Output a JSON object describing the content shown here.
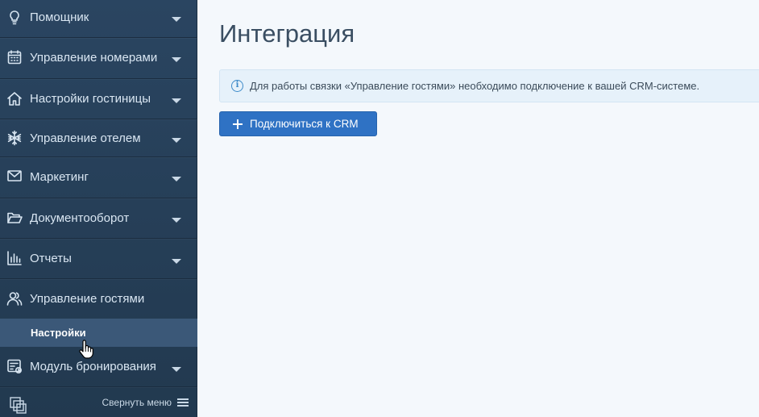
{
  "sidebar": {
    "items": [
      {
        "label": "Помощник",
        "icon": "lightbulb-icon"
      },
      {
        "label": "Управление номерами",
        "icon": "calendar-icon"
      },
      {
        "label": "Настройки гостиницы",
        "icon": "home-icon"
      },
      {
        "label": "Управление отелем",
        "icon": "snowflake-icon"
      },
      {
        "label": "Маркетинг",
        "icon": "envelope-icon"
      },
      {
        "label": "Документооборот",
        "icon": "folder-open-icon"
      },
      {
        "label": "Отчеты",
        "icon": "bar-chart-icon"
      },
      {
        "label": "Управление гостями",
        "icon": "users-icon"
      },
      {
        "label": "Модуль бронирования",
        "icon": "booking-module-icon"
      }
    ],
    "active_subitem": "Настройки",
    "collapse_label": "Свернуть меню"
  },
  "main": {
    "title": "Интеграция",
    "alert_text": "Для работы связки «Управление гостями» необходимо подключение к вашей CRM-системе.",
    "connect_button": "Подключиться к CRM"
  },
  "colors": {
    "sidebar_bg": "#2a4561",
    "active_bg": "#3b5878",
    "primary_button": "#2f72c4",
    "alert_bg": "#e6f1fa",
    "info_accent": "#3d8ac9"
  }
}
